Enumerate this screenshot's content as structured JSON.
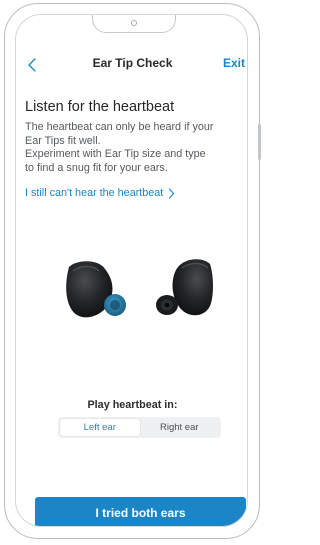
{
  "colors": {
    "accent": "#1a86c7",
    "text_primary": "#262626",
    "text_secondary": "#555a5f",
    "earbud_body": "#1d1f21",
    "ear_tip": "#2a7ea8"
  },
  "header": {
    "back_icon": "chevron-left-icon",
    "title": "Ear Tip Check",
    "exit_label": "Exit"
  },
  "content": {
    "heading": "Listen for the heartbeat",
    "description_lines": [
      "The heartbeat can only be heard if your",
      "Ear Tips fit well.",
      "Experiment with Ear Tip size and type",
      "to find a snug fit for your ears."
    ],
    "help_link": "I still can't hear the heartbeat",
    "help_link_icon": "chevron-right-icon"
  },
  "playback": {
    "label": "Play heartbeat in:",
    "options": [
      "Left ear",
      "Right ear"
    ],
    "selected": "Left ear"
  },
  "footer": {
    "primary_button": "I tried both ears"
  }
}
